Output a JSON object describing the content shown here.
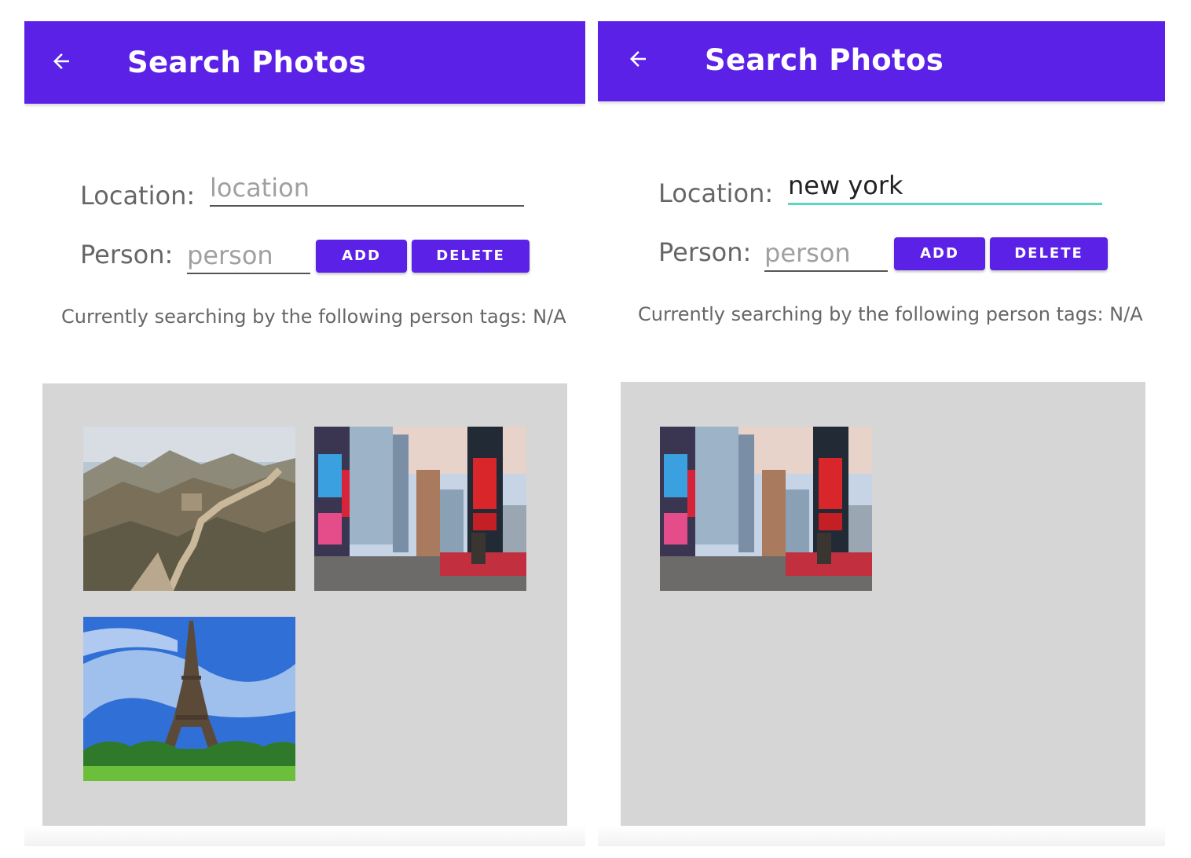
{
  "screens": [
    {
      "appbar": {
        "title": "Search Photos"
      },
      "location": {
        "label": "Location:",
        "value": "",
        "placeholder": "location"
      },
      "person": {
        "label": "Person:",
        "value": "",
        "placeholder": "person"
      },
      "buttons": {
        "add": "ADD",
        "delete": "DELETE"
      },
      "tags_text": "Currently searching by the following person tags: N/A",
      "results": [
        {
          "subject": "great-wall"
        },
        {
          "subject": "times-square"
        },
        {
          "subject": "eiffel-tower"
        }
      ]
    },
    {
      "appbar": {
        "title": "Search Photos"
      },
      "location": {
        "label": "Location:",
        "value": "new york",
        "placeholder": "location"
      },
      "person": {
        "label": "Person:",
        "value": "",
        "placeholder": "person"
      },
      "buttons": {
        "add": "ADD",
        "delete": "DELETE"
      },
      "tags_text": "Currently searching by the following person tags: N/A",
      "results": [
        {
          "subject": "times-square"
        }
      ]
    }
  ],
  "colors": {
    "appbar": "#5b21e6",
    "button": "#5b21e6",
    "focus_underline": "#5ad6c2",
    "gallery_bg": "#d6d6d6"
  }
}
